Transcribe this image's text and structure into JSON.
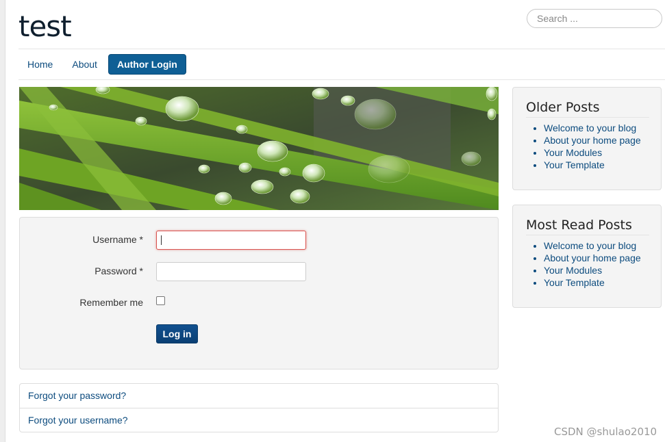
{
  "header": {
    "site_title": "test",
    "search_placeholder": "Search ..."
  },
  "nav": {
    "items": [
      {
        "label": "Home"
      },
      {
        "label": "About"
      },
      {
        "label": "Author Login"
      }
    ],
    "active": "Author Login"
  },
  "banner": {
    "image_icon": "grass-with-raindrops-photo"
  },
  "login": {
    "username_label": "Username *",
    "username_value": "",
    "password_label": "Password *",
    "password_value": "",
    "remember_label": "Remember me",
    "remember_checked": false,
    "submit_label": "Log in"
  },
  "links": {
    "forgot_password": "Forgot your password?",
    "forgot_username": "Forgot your username?"
  },
  "sidebar": {
    "older_posts": {
      "title": "Older Posts",
      "items": [
        "Welcome to your blog",
        "About your home page",
        "Your Modules",
        "Your Template"
      ]
    },
    "most_read": {
      "title": "Most Read Posts",
      "items": [
        "Welcome to your blog",
        "About your home page",
        "Your Modules",
        "Your Template"
      ]
    }
  },
  "watermark": "CSDN @shulao2010",
  "colors": {
    "link": "#0c4b7e",
    "nav_active_bg": "#0f5f95",
    "button_bg": "#0a3f73",
    "error_border": "#d9534f"
  }
}
